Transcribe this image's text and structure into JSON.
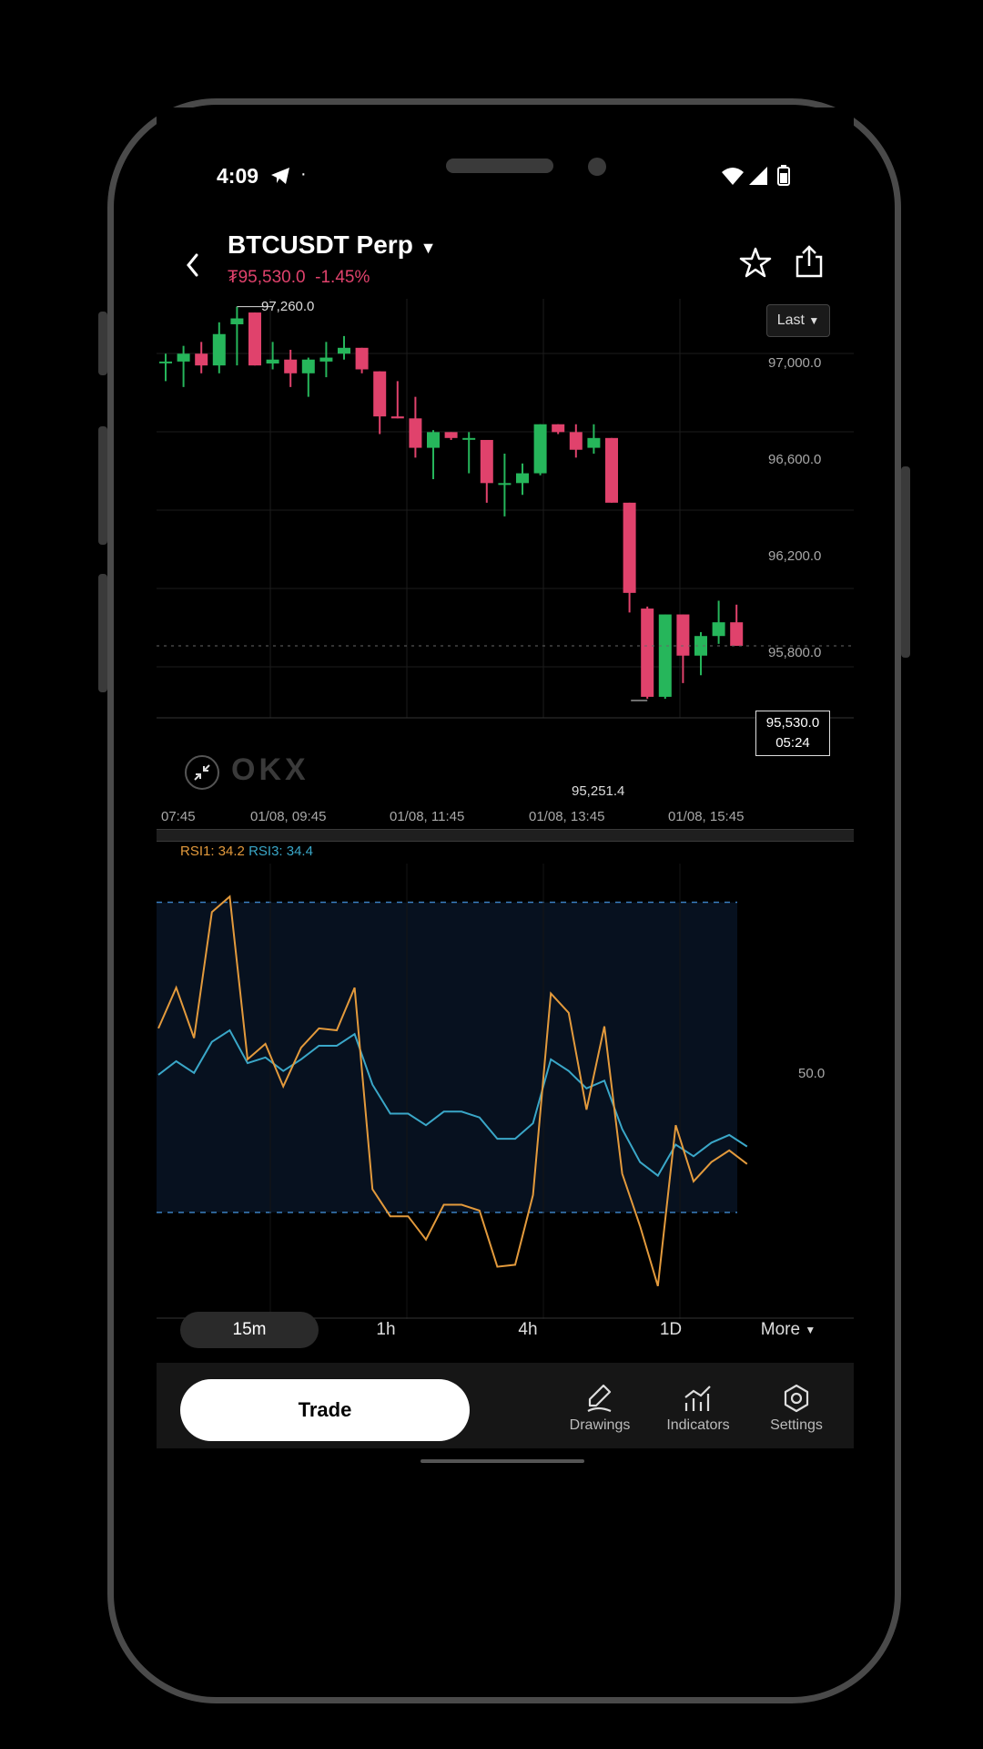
{
  "status": {
    "time": "4:09",
    "dot": "·"
  },
  "header": {
    "symbol": "BTCUSDT Perp",
    "price": "₮95,530.0",
    "change": "-1.45%",
    "colors": {
      "down": "#e0426c",
      "up": "#26b65b"
    }
  },
  "chart": {
    "price_type_button": "Last",
    "high_label": "97,260.0",
    "low_label": "95,251.4",
    "y_ticks": [
      "97,000.0",
      "96,600.0",
      "96,200.0",
      "95,800.0"
    ],
    "current_price": "95,530.0",
    "countdown": "05:24",
    "x_ticks": [
      "07:45",
      "01/08, 09:45",
      "01/08, 11:45",
      "01/08, 13:45",
      "01/08, 15:45"
    ],
    "watermark": "OKX"
  },
  "indicator": {
    "rsi1": "RSI1: 34.2",
    "rsi3": "RSI3: 34.4",
    "mid_tick": "50.0",
    "rsi1_color": "#e39a3c",
    "rsi3_color": "#3aa7c8"
  },
  "timeframes": [
    "15m",
    "1h",
    "4h",
    "1D"
  ],
  "timeframe_active": "15m",
  "more_label": "More",
  "actions": {
    "trade": "Trade",
    "drawings": "Drawings",
    "indicators": "Indicators",
    "settings": "Settings"
  },
  "chart_data": {
    "type": "candlestick",
    "candles": [
      {
        "o": 96980,
        "h": 97020,
        "l": 96880,
        "c": 96980
      },
      {
        "o": 96980,
        "h": 97060,
        "l": 96850,
        "c": 97020
      },
      {
        "o": 97020,
        "h": 97080,
        "l": 96920,
        "c": 96960
      },
      {
        "o": 96960,
        "h": 97180,
        "l": 96920,
        "c": 97120
      },
      {
        "o": 97170,
        "h": 97260,
        "l": 96960,
        "c": 97200
      },
      {
        "o": 97230,
        "h": 97230,
        "l": 96960,
        "c": 96960
      },
      {
        "o": 96970,
        "h": 97080,
        "l": 96940,
        "c": 96990
      },
      {
        "o": 96990,
        "h": 97040,
        "l": 96850,
        "c": 96920
      },
      {
        "o": 96920,
        "h": 97000,
        "l": 96800,
        "c": 96990
      },
      {
        "o": 96980,
        "h": 97080,
        "l": 96900,
        "c": 97000
      },
      {
        "o": 97020,
        "h": 97110,
        "l": 96990,
        "c": 97050
      },
      {
        "o": 97050,
        "h": 97050,
        "l": 96920,
        "c": 96940
      },
      {
        "o": 96930,
        "h": 96930,
        "l": 96610,
        "c": 96700
      },
      {
        "o": 96700,
        "h": 96880,
        "l": 96690,
        "c": 96690
      },
      {
        "o": 96690,
        "h": 96800,
        "l": 96490,
        "c": 96540
      },
      {
        "o": 96540,
        "h": 96630,
        "l": 96380,
        "c": 96620
      },
      {
        "o": 96620,
        "h": 96620,
        "l": 96580,
        "c": 96590
      },
      {
        "o": 96590,
        "h": 96620,
        "l": 96410,
        "c": 96590
      },
      {
        "o": 96580,
        "h": 96580,
        "l": 96260,
        "c": 96360
      },
      {
        "o": 96360,
        "h": 96510,
        "l": 96190,
        "c": 96360
      },
      {
        "o": 96360,
        "h": 96460,
        "l": 96300,
        "c": 96410
      },
      {
        "o": 96410,
        "h": 96660,
        "l": 96400,
        "c": 96660
      },
      {
        "o": 96660,
        "h": 96660,
        "l": 96610,
        "c": 96620
      },
      {
        "o": 96620,
        "h": 96660,
        "l": 96490,
        "c": 96530
      },
      {
        "o": 96540,
        "h": 96660,
        "l": 96510,
        "c": 96590
      },
      {
        "o": 96590,
        "h": 96590,
        "l": 96260,
        "c": 96260
      },
      {
        "o": 96260,
        "h": 96260,
        "l": 95700,
        "c": 95800
      },
      {
        "o": 95720,
        "h": 95730,
        "l": 95260,
        "c": 95270
      },
      {
        "o": 95270,
        "h": 95690,
        "l": 95260,
        "c": 95690
      },
      {
        "o": 95690,
        "h": 95690,
        "l": 95340,
        "c": 95480
      },
      {
        "o": 95480,
        "h": 95600,
        "l": 95380,
        "c": 95580
      },
      {
        "o": 95580,
        "h": 95760,
        "l": 95540,
        "c": 95650
      },
      {
        "o": 95650,
        "h": 95740,
        "l": 95530,
        "c": 95530
      }
    ],
    "y_range": [
      95200,
      97300
    ],
    "rsi1": [
      51.5,
      53.6,
      51.0,
      57.5,
      58.3,
      49.9,
      50.7,
      48.5,
      50.5,
      51.5,
      51.4,
      53.6,
      43.2,
      41.8,
      41.8,
      40.6,
      42.4,
      42.4,
      42.1,
      39.2,
      39.3,
      42.9,
      53.3,
      52.3,
      47.3,
      51.6,
      44.0,
      41.3,
      38.2,
      46.5,
      43.6,
      44.6,
      45.2,
      44.5
    ],
    "rsi3": [
      49.1,
      49.8,
      49.2,
      50.8,
      51.4,
      49.7,
      50.0,
      49.3,
      49.9,
      50.6,
      50.6,
      51.2,
      48.6,
      47.1,
      47.1,
      46.5,
      47.2,
      47.2,
      46.9,
      45.8,
      45.8,
      46.6,
      49.9,
      49.3,
      48.4,
      48.8,
      46.3,
      44.6,
      43.9,
      45.5,
      44.9,
      45.6,
      46.0,
      45.4
    ]
  }
}
